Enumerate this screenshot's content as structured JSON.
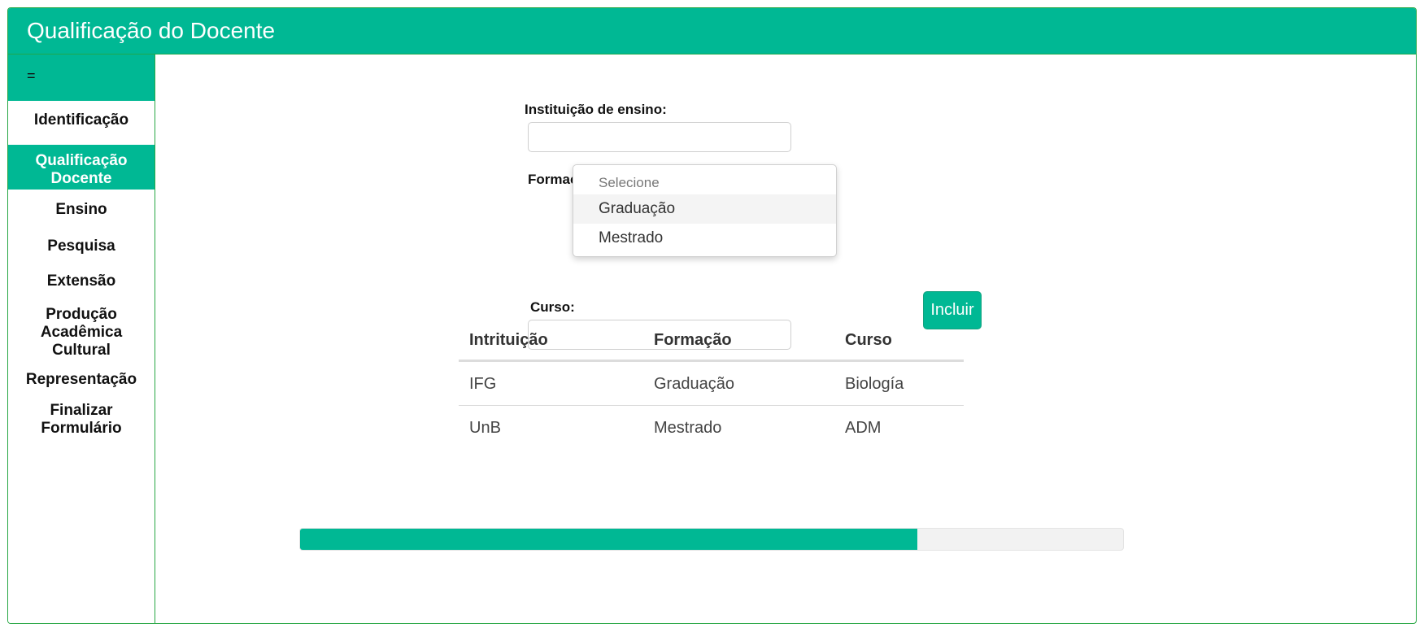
{
  "header": {
    "title": "Qualificação do Docente"
  },
  "sidebar": {
    "toggle_label": "=",
    "items": [
      {
        "label": "Identificação",
        "active": false
      },
      {
        "label": "Qualificação Docente",
        "active": true
      },
      {
        "label": "Ensino",
        "active": false
      },
      {
        "label": "Pesquisa",
        "active": false
      },
      {
        "label": "Extensão",
        "active": false
      },
      {
        "label": "Produção Acadêmica Cultural",
        "active": false
      },
      {
        "label": "Representação",
        "active": false
      },
      {
        "label": "Finalizar Formulário",
        "active": false
      }
    ]
  },
  "form": {
    "instituicao_label": "Instituição de ensino:",
    "instituicao_value": "",
    "formacao_label": "Formação:",
    "formacao_options": {
      "placeholder": "Selecione",
      "items": [
        "Graduação",
        "Mestrado"
      ]
    },
    "curso_label": "Curso:",
    "curso_value": "",
    "incluir_label": "Incluir"
  },
  "table": {
    "headers": [
      "Intrituição",
      "Formação",
      "Curso"
    ],
    "rows": [
      [
        "IFG",
        "Graduação",
        "Biología"
      ],
      [
        "UnB",
        "Mestrado",
        "ADM"
      ]
    ]
  },
  "progress": {
    "value_percent": 75
  },
  "colors": {
    "accent": "#00b894",
    "border": "#27a744"
  }
}
